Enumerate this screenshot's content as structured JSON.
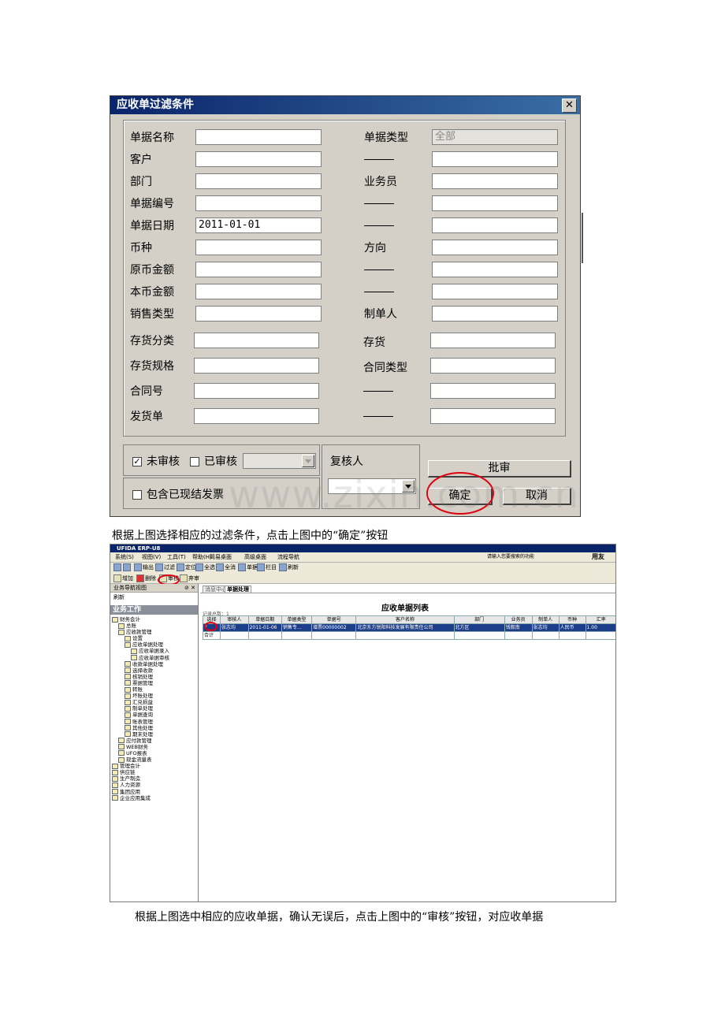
{
  "dialog": {
    "title": "应收单过滤条件",
    "close_glyph": "✕",
    "left_fields": [
      {
        "label": "单据名称",
        "value": "",
        "dropdown": true
      },
      {
        "label": "客户",
        "value": "",
        "dropdown": false
      },
      {
        "label": "部门",
        "value": "",
        "dropdown": false
      },
      {
        "label": "单据编号",
        "value": "",
        "dropdown": false
      },
      {
        "label": "单据日期",
        "value": "2011-01-01",
        "dropdown": false
      },
      {
        "label": "币种",
        "value": "",
        "dropdown": true
      },
      {
        "label": "原币金额",
        "value": "",
        "dropdown": false
      },
      {
        "label": "本币金额",
        "value": "",
        "dropdown": false
      },
      {
        "label": "销售类型",
        "value": "",
        "dropdown": true
      },
      {
        "label": "存货分类",
        "value": "",
        "dropdown": false
      },
      {
        "label": "存货规格",
        "value": "",
        "dropdown": false
      },
      {
        "label": "合同号",
        "value": "",
        "dropdown": false
      },
      {
        "label": "发货单",
        "value": "",
        "dropdown": false
      }
    ],
    "right_fields": [
      {
        "label": "单据类型",
        "value": "全部",
        "dropdown": true,
        "disabled": true
      },
      {
        "label": "——",
        "value": "",
        "dropdown": false
      },
      {
        "label": "业务员",
        "value": "",
        "dropdown": false
      },
      {
        "label": "——",
        "value": "",
        "dropdown": false
      },
      {
        "label": "——",
        "value": "",
        "dropdown": false
      },
      {
        "label": "方向",
        "value": "",
        "dropdown": true
      },
      {
        "label": "——",
        "value": "",
        "dropdown": false
      },
      {
        "label": "——",
        "value": "",
        "dropdown": false
      },
      {
        "label": "制单人",
        "value": "",
        "dropdown": true
      },
      {
        "label": "存货",
        "value": "",
        "dropdown": false
      },
      {
        "label": "合同类型",
        "value": "",
        "dropdown": true
      },
      {
        "label": "——",
        "value": "",
        "dropdown": false
      },
      {
        "label": "——",
        "value": "",
        "dropdown": false
      }
    ],
    "unaudited_label": "未审核",
    "unaudited_checked": true,
    "audited_label": "已审核",
    "audited_checked": false,
    "include_settled_label": "包含已现结发票",
    "include_settled_checked": false,
    "reviewer_label": "复核人",
    "approve_button": "批审",
    "ok_button": "确定",
    "cancel_button": "取消",
    "watermark": "www.zixin.com.cn"
  },
  "caption1": "根据上图选择相应的过滤条件，点击上图中的“确定”按钮",
  "app": {
    "title": "UFIDA ERP-U8",
    "menu": [
      "系统(S)",
      "视图(V)",
      "工具(T)",
      "帮助(H)",
      "简易桌面",
      "高级桌面",
      "流程导航"
    ],
    "search_hint": "请输入您要搜索的功能",
    "user_label": "用友",
    "toolbar": [
      "打印",
      "预览",
      "输出",
      "过滤",
      "定位",
      "全选",
      "全消",
      "单据",
      "栏目",
      "刷新"
    ],
    "toolbar2": [
      "增加",
      "删除",
      "审核",
      "弃审"
    ],
    "nav_header": "业务导航视图",
    "nav_close": "⊘ ✕",
    "nav_refresh": "刷新",
    "nav_section": "业务工作",
    "tree": [
      {
        "d": 0,
        "t": "财务会计"
      },
      {
        "d": 1,
        "t": "总账"
      },
      {
        "d": 1,
        "t": "应收款管理"
      },
      {
        "d": 2,
        "t": "设置"
      },
      {
        "d": 2,
        "t": "应收单据处理"
      },
      {
        "d": 3,
        "t": "应收单据录入"
      },
      {
        "d": 3,
        "t": "应收单据审核"
      },
      {
        "d": 2,
        "t": "收款单据处理"
      },
      {
        "d": 2,
        "t": "选择收款"
      },
      {
        "d": 2,
        "t": "核销处理"
      },
      {
        "d": 2,
        "t": "票据管理"
      },
      {
        "d": 2,
        "t": "转账"
      },
      {
        "d": 2,
        "t": "坏账处理"
      },
      {
        "d": 2,
        "t": "汇兑损益"
      },
      {
        "d": 2,
        "t": "制单处理"
      },
      {
        "d": 2,
        "t": "单据查询"
      },
      {
        "d": 2,
        "t": "账表管理"
      },
      {
        "d": 2,
        "t": "其他处理"
      },
      {
        "d": 2,
        "t": "期末处理"
      },
      {
        "d": 1,
        "t": "应付款管理"
      },
      {
        "d": 1,
        "t": "WEB财务"
      },
      {
        "d": 1,
        "t": "UFO报表"
      },
      {
        "d": 1,
        "t": "现金流量表"
      },
      {
        "d": 0,
        "t": "管理会计"
      },
      {
        "d": 0,
        "t": "供应链"
      },
      {
        "d": 0,
        "t": "生产制造"
      },
      {
        "d": 0,
        "t": "人力资源"
      },
      {
        "d": 0,
        "t": "集团应用"
      },
      {
        "d": 0,
        "t": "企业应用集成"
      }
    ],
    "tabs": [
      "消息中心",
      "单据处理"
    ],
    "grid_title": "应收单据列表",
    "record_count": "记录总数：1",
    "columns": [
      "选择",
      "审核人",
      "单据日期",
      "单据类型",
      "单据号",
      "客户名称",
      "部门",
      "业务员",
      "制单人",
      "币种",
      "汇率"
    ],
    "rows": [
      [
        "Y",
        "张志均",
        "2011-01-06",
        "销售专…",
        "增票00000002",
        "北京东方锐阳科技发展有限责任公司",
        "北方区",
        "钱叙南",
        "张志均",
        "人民币",
        "1.00"
      ]
    ],
    "total_label": "合计"
  },
  "caption2": "根据上图选中相应的应收单据，确认无误后，点击上图中的“审核”按钮，对应收单据"
}
